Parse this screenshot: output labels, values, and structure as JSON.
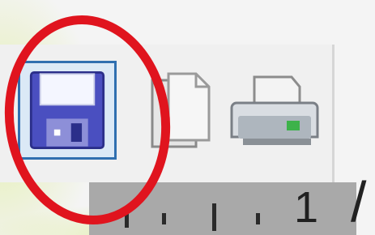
{
  "toolbar": {
    "buttons": [
      {
        "name": "save",
        "icon": "floppy-disk-icon",
        "selected": true
      },
      {
        "name": "copy",
        "icon": "copy-icon",
        "selected": false
      },
      {
        "name": "print",
        "icon": "printer-icon",
        "selected": false
      }
    ]
  },
  "ruler": {
    "label": "1",
    "trailing": "/"
  },
  "colors": {
    "highlight_circle": "#e0141e",
    "selected_border": "#2f6fb0",
    "selected_bg": "#dbe9f6",
    "floppy": "#4a4fc0",
    "ruler_bg": "#a9a9a9",
    "accent_green": "#d6eb78"
  }
}
